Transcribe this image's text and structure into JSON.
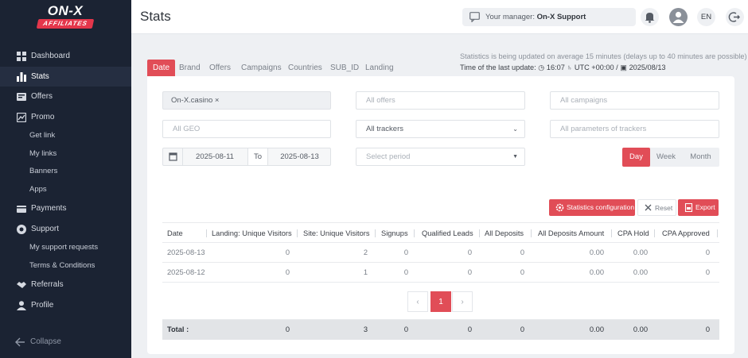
{
  "brand": {
    "top": "ON-X",
    "badge": "AFFILIATES"
  },
  "sidebar": {
    "items": [
      {
        "label": "Dashboard",
        "icon": "dashboard-icon"
      },
      {
        "label": "Stats",
        "icon": "bar-chart-icon",
        "active": true
      },
      {
        "label": "Offers",
        "icon": "offers-icon"
      },
      {
        "label": "Promo",
        "icon": "promo-icon"
      },
      {
        "label": "Payments",
        "icon": "wallet-icon"
      },
      {
        "label": "Support",
        "icon": "support-icon"
      },
      {
        "label": "Referrals",
        "icon": "handshake-icon"
      },
      {
        "label": "Profile",
        "icon": "user-icon"
      }
    ],
    "promo_sub": [
      "Get link",
      "My links",
      "Banners",
      "Apps"
    ],
    "support_sub": [
      "My support requests",
      "Terms & Conditions"
    ],
    "collapse": "Collapse"
  },
  "header": {
    "title": "Stats",
    "manager_prefix": "Your manager:",
    "manager_name": "On-X Support",
    "lang": "EN"
  },
  "tabs": [
    "Date",
    "Brand",
    "Offers",
    "Campaigns",
    "Countries",
    "SUB_ID",
    "Landing"
  ],
  "info": {
    "line1": "Statistics is being updated on average 15 minutes (delays up to 40 minutes are possible)",
    "line2_prefix": "Time of the last update:",
    "time": "16:07",
    "tz": "UTC +00:00 /",
    "date": "2025/08/13"
  },
  "filters": {
    "brand_value": "On-X.casino",
    "offers_placeholder": "All offers",
    "campaigns_placeholder": "All campaigns",
    "geo_placeholder": "All GEO",
    "trackers_value": "All trackers",
    "params_placeholder": "All parameters of trackers",
    "date_from": "2025-08-11",
    "date_to_label": "To",
    "date_to": "2025-08-13",
    "period_placeholder": "Select period"
  },
  "period_buttons": [
    "Day",
    "Week",
    "Month"
  ],
  "actions": {
    "config": "Statistics configuration",
    "reset": "Reset",
    "export": "Export"
  },
  "table": {
    "headers": [
      "Date",
      "Landing: Unique Visitors",
      "Site: Unique Visitors",
      "Signups",
      "Qualified Leads",
      "All Deposits",
      "All Deposits Amount",
      "CPA Hold",
      "CPA Approved"
    ],
    "rows": [
      [
        "2025-08-13",
        "0",
        "2",
        "0",
        "0",
        "0",
        "0.00",
        "0.00",
        "0"
      ],
      [
        "2025-08-12",
        "0",
        "1",
        "0",
        "0",
        "0",
        "0.00",
        "0.00",
        "0"
      ]
    ],
    "total": [
      "Total :",
      "0",
      "3",
      "0",
      "0",
      "0",
      "0.00",
      "0.00",
      "0"
    ]
  },
  "pagination": {
    "prev": "‹",
    "page": "1",
    "next": "›"
  },
  "colors": {
    "accent": "#e14d57",
    "sidebar": "#1b2333"
  }
}
